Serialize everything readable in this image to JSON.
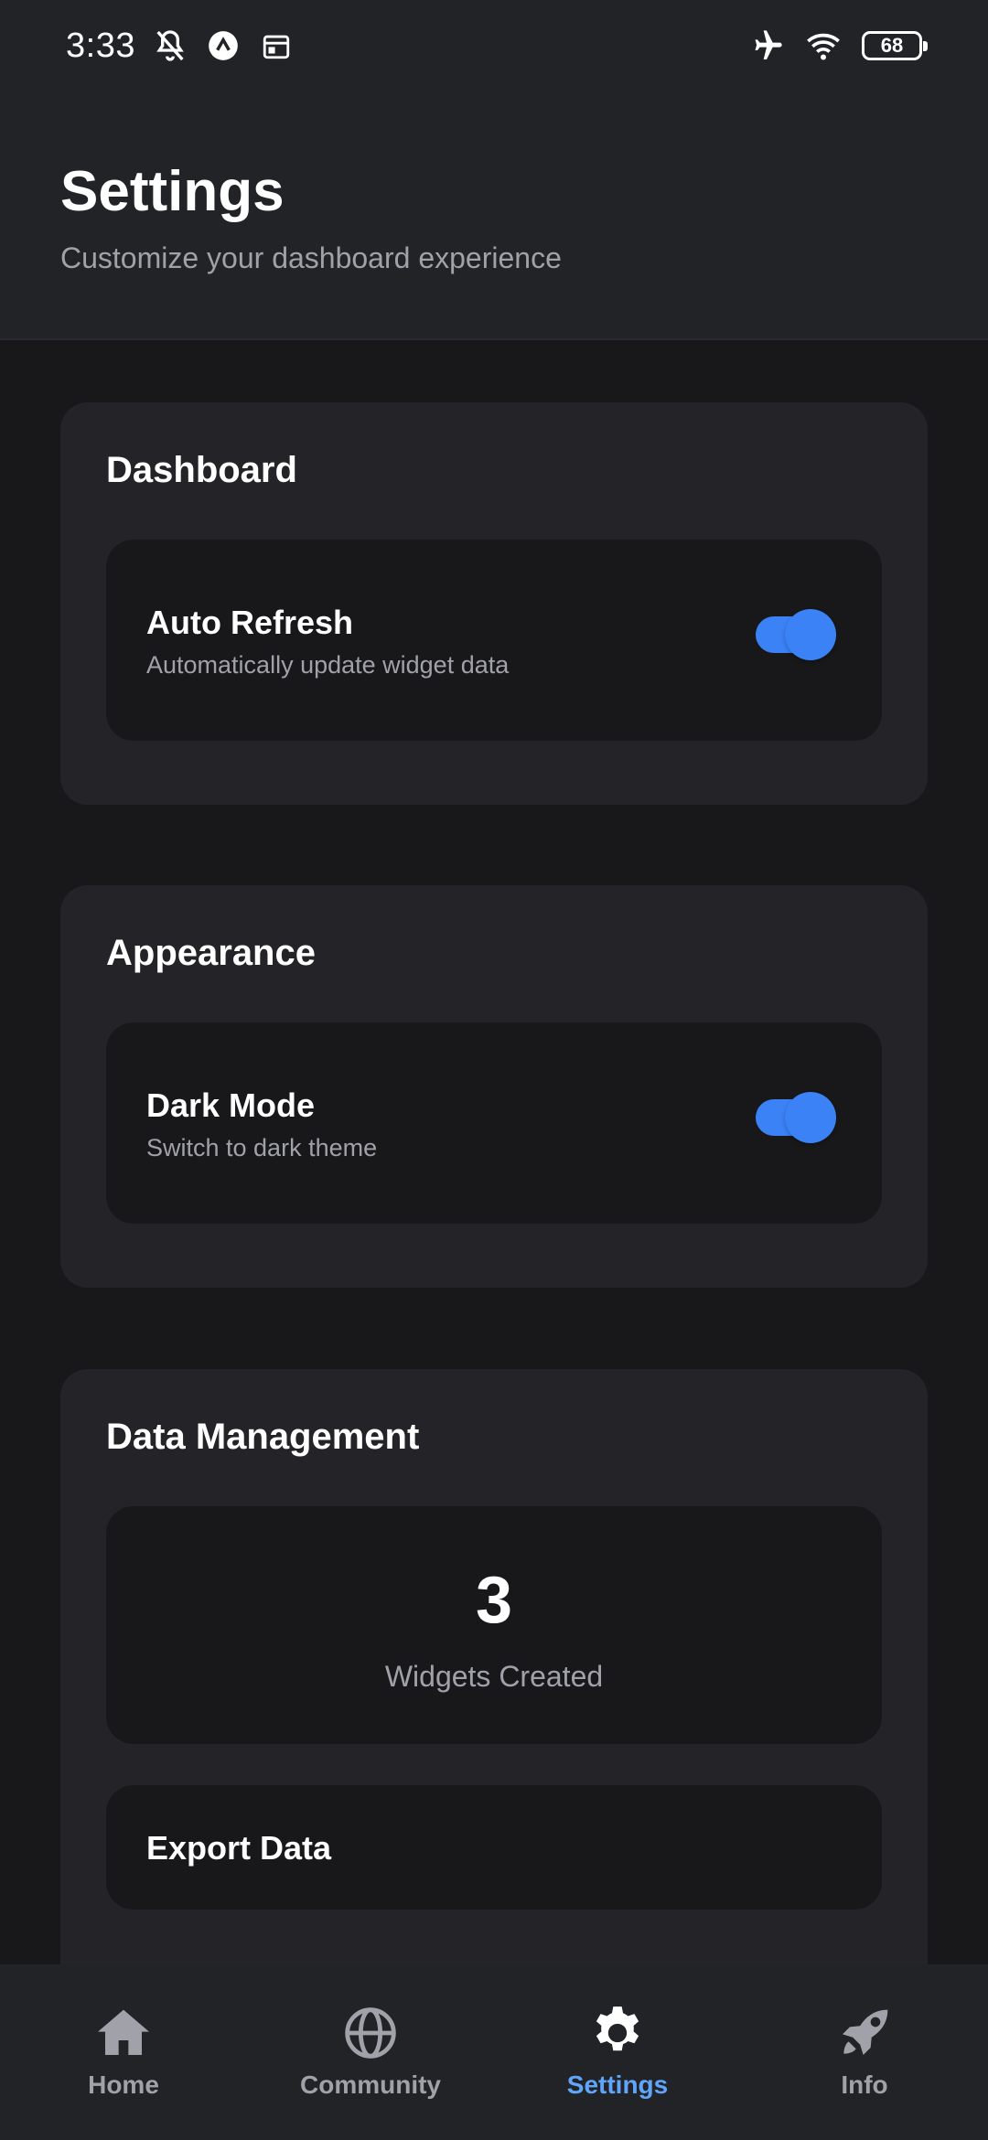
{
  "status_bar": {
    "time": "3:33",
    "battery": "68",
    "icons": [
      "muted-bell-icon",
      "app-notification-icon",
      "calendar-icon",
      "airplane-mode-icon",
      "wifi-icon",
      "battery-icon"
    ]
  },
  "header": {
    "title": "Settings",
    "subtitle": "Customize your dashboard experience"
  },
  "sections": {
    "dashboard": {
      "title": "Dashboard",
      "auto_refresh": {
        "label": "Auto Refresh",
        "description": "Automatically update widget data",
        "enabled": true
      }
    },
    "appearance": {
      "title": "Appearance",
      "dark_mode": {
        "label": "Dark Mode",
        "description": "Switch to dark theme",
        "enabled": true
      }
    },
    "data_management": {
      "title": "Data Management",
      "widgets_count": "3",
      "widgets_label": "Widgets Created",
      "export_label": "Export Data"
    }
  },
  "nav": {
    "items": [
      {
        "label": "Home",
        "icon": "home-icon",
        "active": false
      },
      {
        "label": "Community",
        "icon": "globe-icon",
        "active": false
      },
      {
        "label": "Settings",
        "icon": "gear-icon",
        "active": true
      },
      {
        "label": "Info",
        "icon": "rocket-icon",
        "active": false
      }
    ]
  },
  "colors": {
    "background": "#18181b",
    "surface": "#242428",
    "accent": "#3b82f6",
    "active_nav": "#60a5fa",
    "muted_text": "#a1a1aa"
  }
}
